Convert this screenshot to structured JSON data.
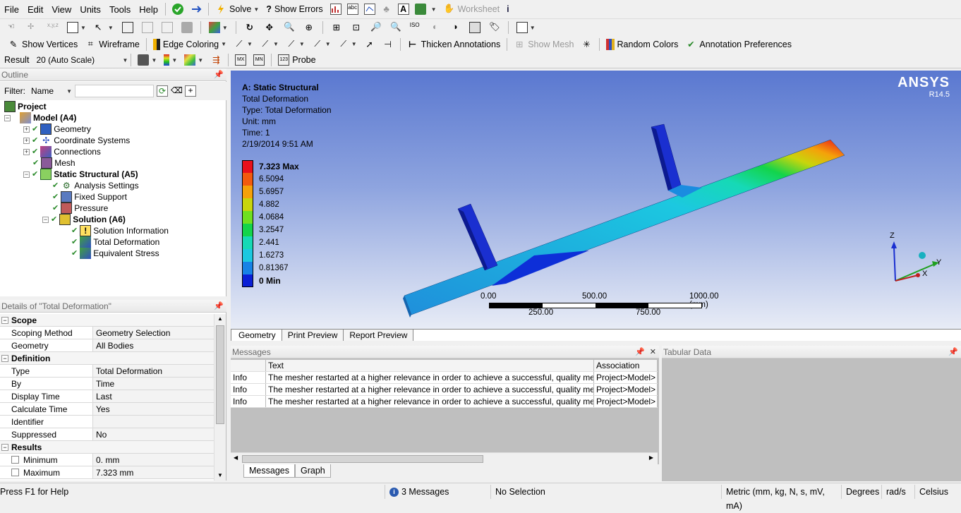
{
  "menu": [
    "File",
    "Edit",
    "View",
    "Units",
    "Tools",
    "Help"
  ],
  "toolbar1": {
    "solve": "Solve",
    "show_errors": "Show Errors",
    "worksheet": "Worksheet"
  },
  "toolbar2": {
    "show_vertices": "Show Vertices",
    "wireframe": "Wireframe",
    "edge_coloring": "Edge Coloring",
    "thicken_annotations": "Thicken Annotations",
    "show_mesh": "Show Mesh",
    "random_colors": "Random Colors",
    "annotation_preferences": "Annotation Preferences"
  },
  "toolbar3": {
    "result_label": "Result",
    "scale": "20 (Auto Scale)",
    "probe": "Probe"
  },
  "outline": {
    "title": "Outline",
    "filter_label": "Filter:",
    "filter_value": "Name",
    "tree": [
      {
        "label": "Project",
        "bold": true
      },
      {
        "label": "Model (A4)",
        "bold": true
      },
      {
        "label": "Geometry"
      },
      {
        "label": "Coordinate Systems"
      },
      {
        "label": "Connections"
      },
      {
        "label": "Mesh"
      },
      {
        "label": "Static Structural (A5)",
        "bold": true
      },
      {
        "label": "Analysis Settings"
      },
      {
        "label": "Fixed Support"
      },
      {
        "label": "Pressure"
      },
      {
        "label": "Solution (A6)",
        "bold": true
      },
      {
        "label": "Solution Information"
      },
      {
        "label": "Total Deformation"
      },
      {
        "label": "Equivalent Stress"
      }
    ]
  },
  "details": {
    "title": "Details of \"Total Deformation\"",
    "sections": [
      {
        "name": "Scope",
        "rows": [
          [
            "Scoping Method",
            "Geometry Selection"
          ],
          [
            "Geometry",
            "All Bodies"
          ]
        ]
      },
      {
        "name": "Definition",
        "rows": [
          [
            "Type",
            "Total Deformation"
          ],
          [
            "By",
            "Time"
          ],
          [
            "Display Time",
            "Last"
          ],
          [
            "Calculate Time History",
            "Yes"
          ],
          [
            "Identifier",
            ""
          ],
          [
            "Suppressed",
            "No"
          ]
        ]
      },
      {
        "name": "Results",
        "rows": [
          [
            "Minimum",
            "0. mm"
          ],
          [
            "Maximum",
            "7.323 mm"
          ]
        ]
      }
    ]
  },
  "viewport": {
    "header": [
      "A: Static Structural",
      "Total Deformation",
      "Type: Total Deformation",
      "Unit: mm",
      "Time: 1",
      "2/19/2014 9:51 AM"
    ],
    "legend": [
      {
        "label": "7.323 Max",
        "color": "#e8101c",
        "bold": true
      },
      {
        "label": "6.5094",
        "color": "#f25a0f"
      },
      {
        "label": "5.6957",
        "color": "#f5a10a"
      },
      {
        "label": "4.882",
        "color": "#c8d50c"
      },
      {
        "label": "4.0684",
        "color": "#6fe020"
      },
      {
        "label": "3.2547",
        "color": "#13d44b"
      },
      {
        "label": "2.441",
        "color": "#16d9b6"
      },
      {
        "label": "1.6273",
        "color": "#1cc8e0"
      },
      {
        "label": "0.81367",
        "color": "#1782e6"
      },
      {
        "label": "0 Min",
        "color": "#0a1fd6",
        "bold": true
      }
    ],
    "logo": "ANSYS",
    "version": "R14.5",
    "scale_top": [
      "0.00",
      "500.00",
      "1000.00 (mm)"
    ],
    "scale_bottom": [
      "250.00",
      "750.00"
    ],
    "triad": {
      "z": "Z",
      "y": "Y",
      "x": "X"
    }
  },
  "view_tabs": [
    "Geometry",
    "Print Preview",
    "Report Preview"
  ],
  "messages": {
    "title": "Messages",
    "columns": [
      "",
      "Text",
      "Association"
    ],
    "rows": [
      [
        "Info",
        "The mesher restarted at a higher relevance in order to achieve a successful, quality mes",
        "Project>Model>"
      ],
      [
        "Info",
        "The mesher restarted at a higher relevance in order to achieve a successful, quality mes",
        "Project>Model>"
      ],
      [
        "Info",
        "The mesher restarted at a higher relevance in order to achieve a successful, quality mes",
        "Project>Model>"
      ]
    ],
    "tabs": [
      "Messages",
      "Graph"
    ]
  },
  "tabular": {
    "title": "Tabular Data"
  },
  "status": {
    "help": "Press F1 for Help",
    "messages": "3 Messages",
    "selection": "No Selection",
    "units": "Metric (mm, kg, N, s, mV, mA)",
    "degrees": "Degrees",
    "rads": "rad/s",
    "temp": "Celsius"
  }
}
